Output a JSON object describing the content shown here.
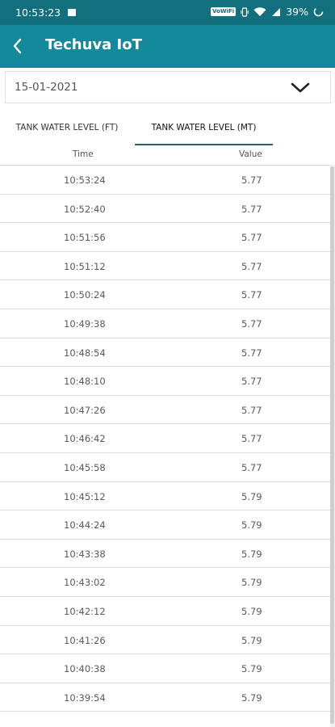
{
  "status_bar": {
    "time": "10:53:23",
    "volte": "VoWiFi",
    "battery": "39%"
  },
  "app_bar": {
    "title": "Techuva IoT"
  },
  "date_select": {
    "value": "15-01-2021"
  },
  "tabs": [
    {
      "label": "TANK WATER LEVEL (FT)",
      "active": false
    },
    {
      "label": "TANK WATER LEVEL (MT)",
      "active": true
    }
  ],
  "table": {
    "headers": {
      "time": "Time",
      "value": "Value"
    },
    "rows": [
      {
        "time": "10:53:24",
        "value": "5.77"
      },
      {
        "time": "10:52:40",
        "value": "5.77"
      },
      {
        "time": "10:51:56",
        "value": "5.77"
      },
      {
        "time": "10:51:12",
        "value": "5.77"
      },
      {
        "time": "10:50:24",
        "value": "5.77"
      },
      {
        "time": "10:49:38",
        "value": "5.77"
      },
      {
        "time": "10:48:54",
        "value": "5.77"
      },
      {
        "time": "10:48:10",
        "value": "5.77"
      },
      {
        "time": "10:47:26",
        "value": "5.77"
      },
      {
        "time": "10:46:42",
        "value": "5.77"
      },
      {
        "time": "10:45:58",
        "value": "5.77"
      },
      {
        "time": "10:45:12",
        "value": "5.79"
      },
      {
        "time": "10:44:24",
        "value": "5.79"
      },
      {
        "time": "10:43:38",
        "value": "5.79"
      },
      {
        "time": "10:43:02",
        "value": "5.79"
      },
      {
        "time": "10:42:12",
        "value": "5.79"
      },
      {
        "time": "10:41:26",
        "value": "5.79"
      },
      {
        "time": "10:40:38",
        "value": "5.79"
      },
      {
        "time": "10:39:54",
        "value": "5.79"
      }
    ]
  },
  "colors": {
    "status_bar": "#126f7e",
    "app_bar": "#14899b",
    "tab_indicator": "#2b5f6a"
  },
  "icons": {
    "back": "back-arrow-icon",
    "dropdown": "chevron-down-icon"
  }
}
